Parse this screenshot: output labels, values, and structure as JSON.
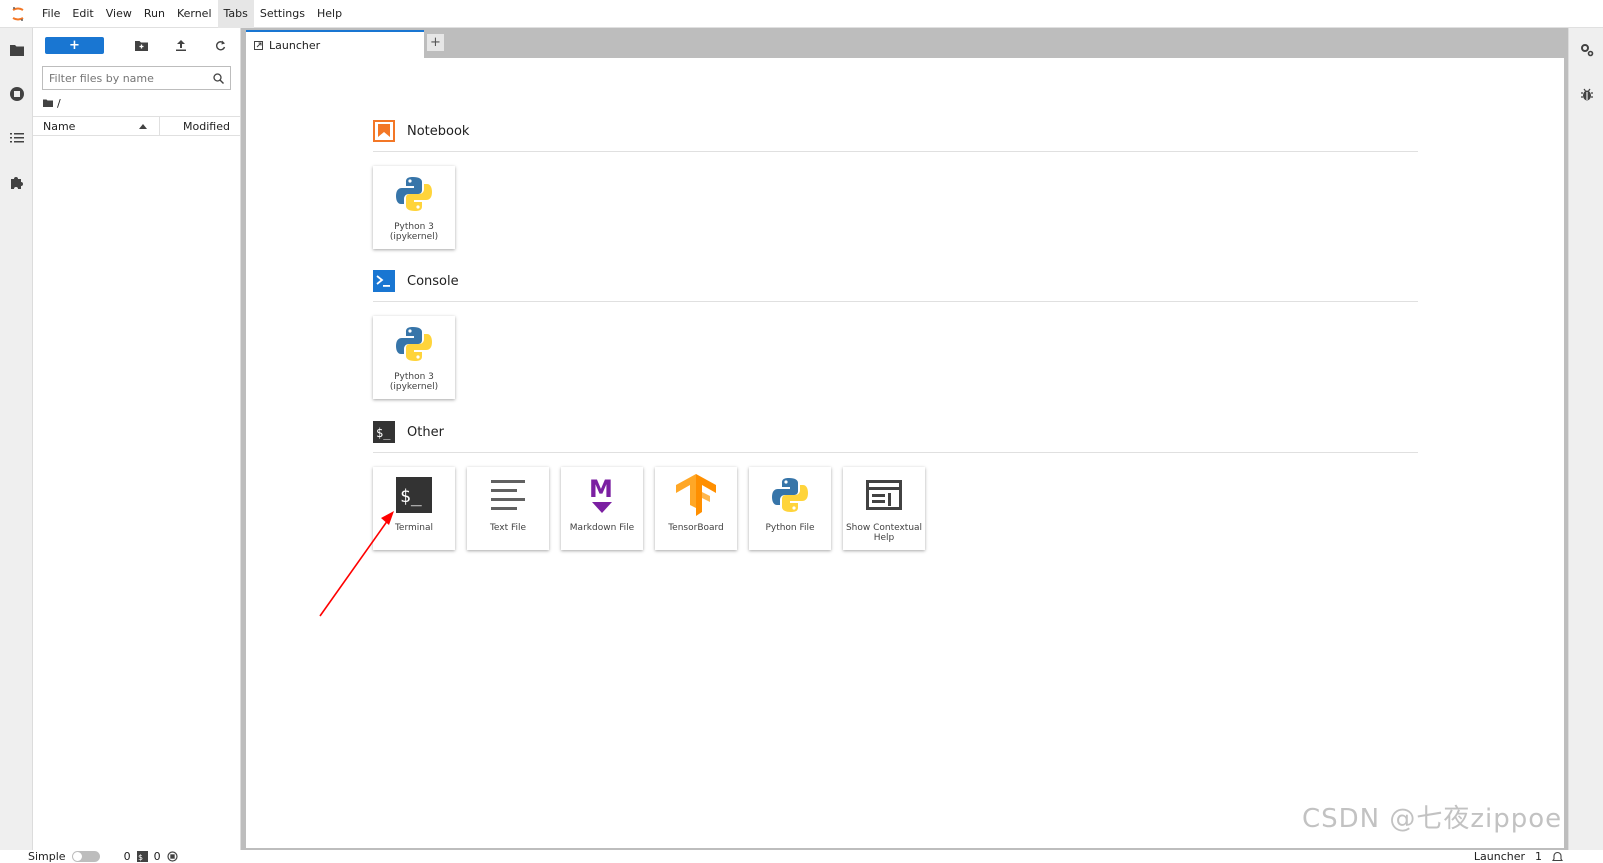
{
  "menubar": {
    "items": [
      "File",
      "Edit",
      "View",
      "Run",
      "Kernel",
      "Tabs",
      "Settings",
      "Help"
    ]
  },
  "filebrowser": {
    "new_label": "+",
    "filter_placeholder": "Filter files by name",
    "breadcrumb": "/",
    "col_name": "Name",
    "col_modified": "Modified"
  },
  "tabs": {
    "launcher_label": "Launcher",
    "add_label": "+"
  },
  "launcher": {
    "notebook": {
      "title": "Notebook",
      "cards": [
        {
          "label": "Python 3 (ipykernel)"
        }
      ]
    },
    "console": {
      "title": "Console",
      "cards": [
        {
          "label": "Python 3 (ipykernel)"
        }
      ]
    },
    "other": {
      "title": "Other",
      "cards": [
        {
          "label": "Terminal"
        },
        {
          "label": "Text File"
        },
        {
          "label": "Markdown File"
        },
        {
          "label": "TensorBoard"
        },
        {
          "label": "Python File"
        },
        {
          "label": "Show Contextual Help"
        }
      ]
    }
  },
  "statusbar": {
    "mode": "Simple",
    "terminals": "0",
    "kernels": "0",
    "active_tab": "Launcher",
    "tab_count": "1"
  },
  "watermark": "CSDN @七夜zippoe",
  "colors": {
    "accent": "#1976d2",
    "notebook_icon": "#f37726",
    "console_icon": "#1976d2",
    "markdown_icon": "#7b1fa2",
    "annotation_arrow": "#ff0000"
  }
}
